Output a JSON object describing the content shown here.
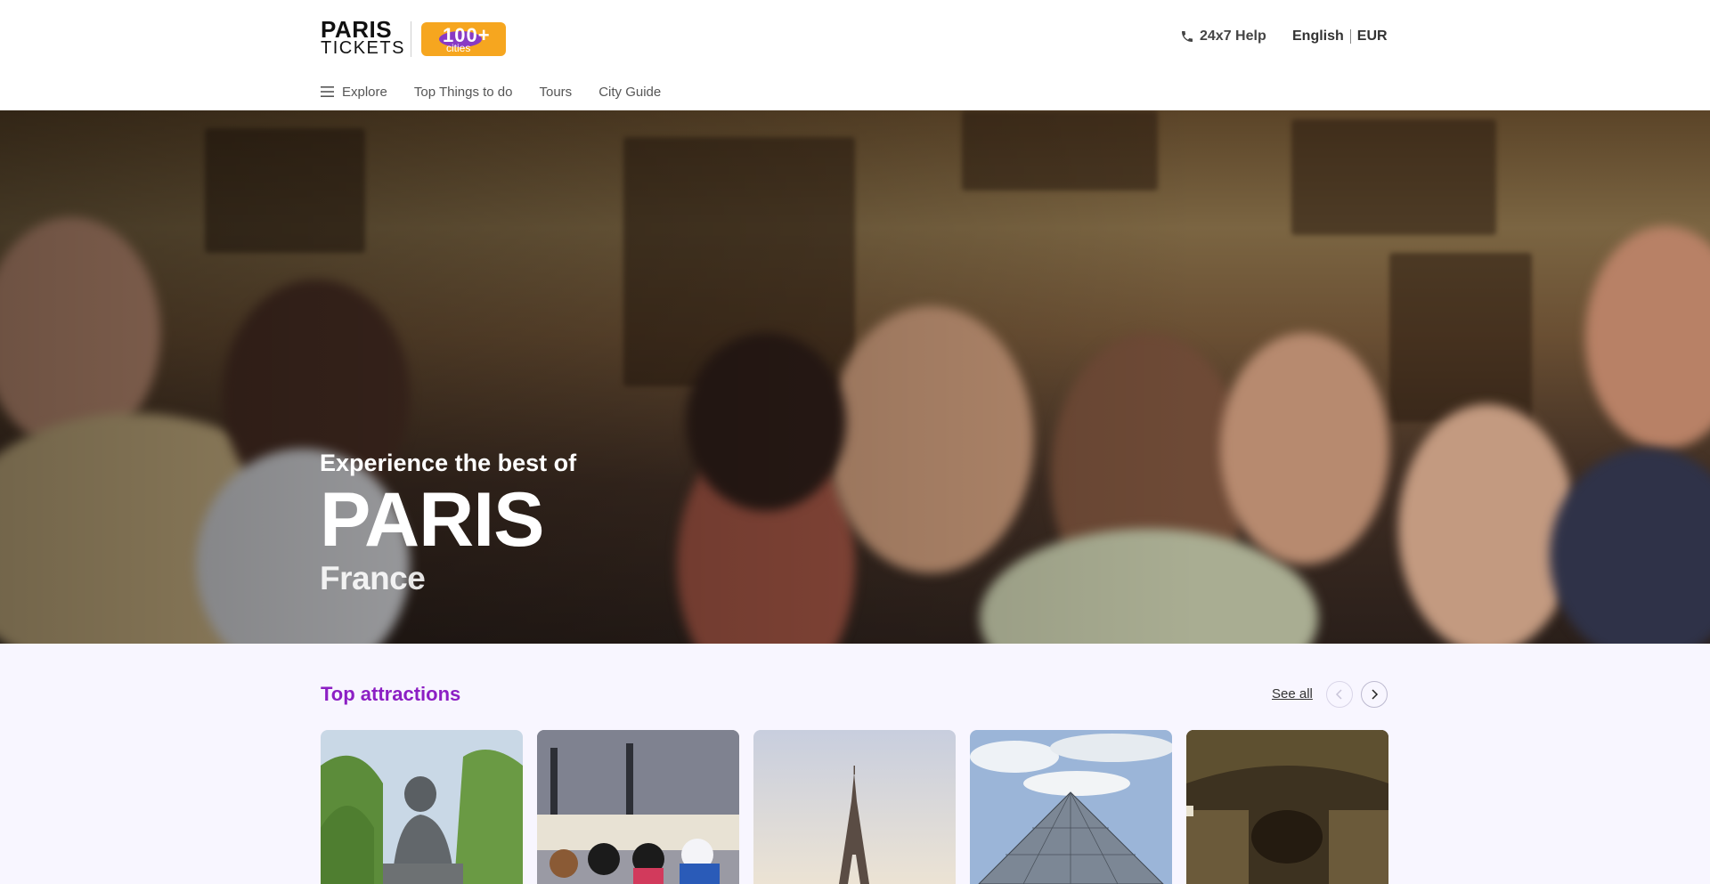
{
  "header": {
    "logo": {
      "line1": "PARIS",
      "line2": "TICKETS"
    },
    "badge": {
      "number": "100+",
      "sub": "cities"
    },
    "help_label": "24x7 Help",
    "language": "English",
    "currency": "EUR"
  },
  "nav": {
    "items": [
      {
        "label": "Explore",
        "icon": "menu-icon"
      },
      {
        "label": "Top Things to do"
      },
      {
        "label": "Tours"
      },
      {
        "label": "City Guide"
      }
    ]
  },
  "hero": {
    "subtitle": "Experience the best of",
    "city": "PARIS",
    "country": "France"
  },
  "attractions": {
    "title": "Top attractions",
    "see_all": "See all",
    "cards": [
      {
        "name": "rodin-museum"
      },
      {
        "name": "disneyland"
      },
      {
        "name": "eiffel-tower"
      },
      {
        "name": "louvre"
      },
      {
        "name": "catacombs"
      }
    ]
  },
  "colors": {
    "accent": "#8c1fc4",
    "badge": "#f6a61f",
    "background": "#f8f6ff"
  }
}
